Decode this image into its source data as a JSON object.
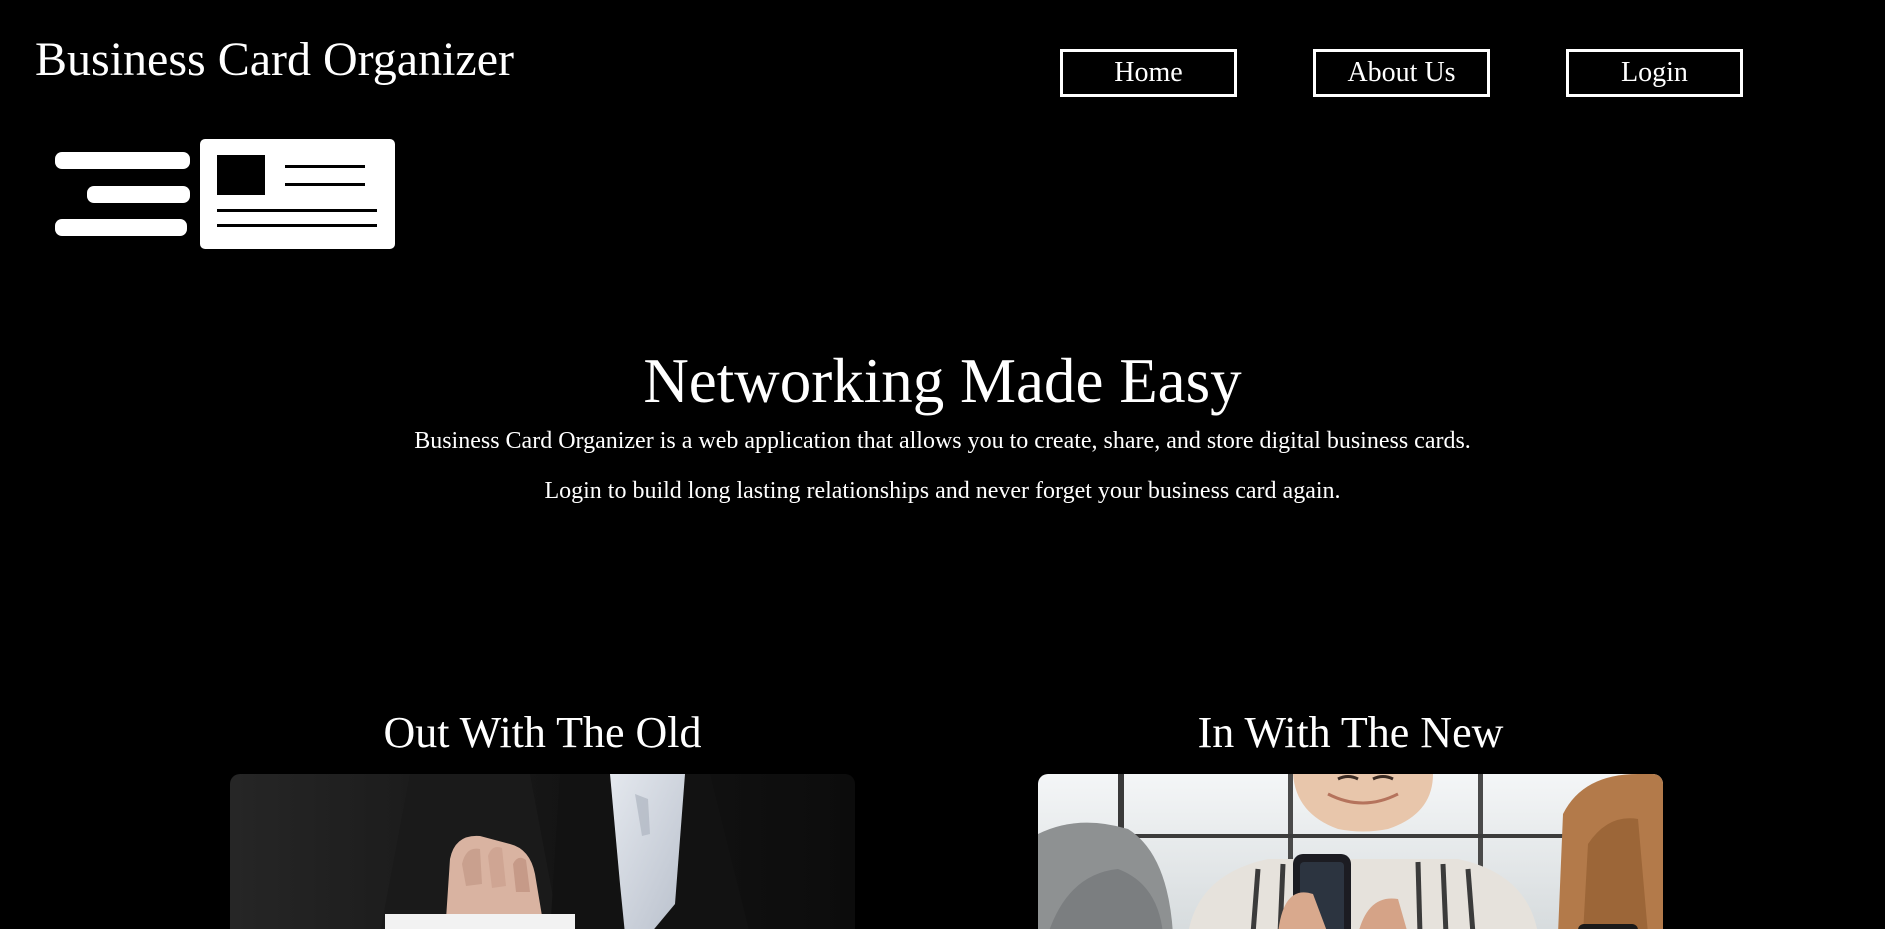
{
  "header": {
    "title": "Business Card Organizer"
  },
  "nav": {
    "home_label": "Home",
    "about_label": "About Us",
    "login_label": "Login"
  },
  "logo": {
    "icon": "business-card-logo-icon"
  },
  "hero": {
    "title": "Networking Made Easy",
    "description": "Business Card Organizer is a web application that allows you to create, share, and store digital business cards.",
    "cta_text": "Login to build long lasting relationships and never forget your business card again."
  },
  "sections": {
    "old": {
      "title": "Out With The Old",
      "image": "person-holding-paper-business-card-photo"
    },
    "new": {
      "title": "In With The New",
      "image": "people-using-smartphones-photo"
    }
  },
  "colors": {
    "background": "#000000",
    "text": "#ffffff"
  }
}
